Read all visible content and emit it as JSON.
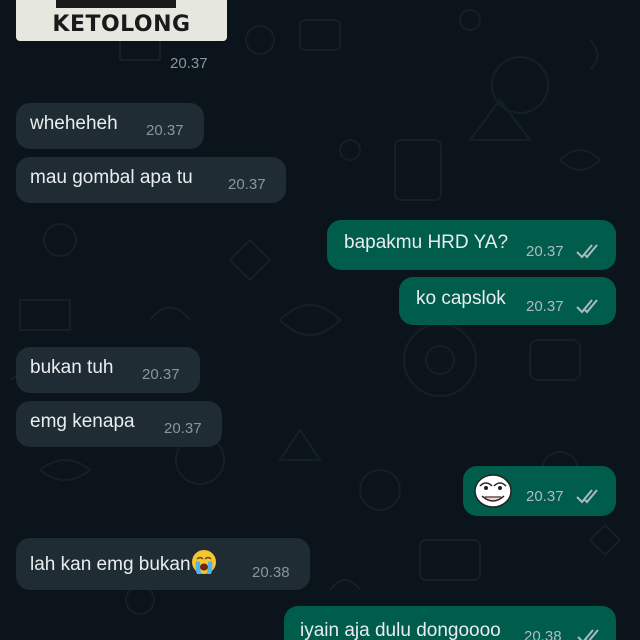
{
  "sticker": {
    "caption": "KETOLONG",
    "time": "20.37"
  },
  "messages": [
    {
      "direction": "in",
      "text": "wheheheh",
      "time": "20.37"
    },
    {
      "direction": "in",
      "text": "mau gombal apa tu",
      "time": "20.37"
    },
    {
      "direction": "out",
      "text": "bapakmu HRD YA?",
      "time": "20.37",
      "status": "read"
    },
    {
      "direction": "out",
      "text": "ko capslok",
      "time": "20.37",
      "status": "read"
    },
    {
      "direction": "in",
      "text": "bukan tuh",
      "time": "20.37"
    },
    {
      "direction": "in",
      "text": "emg kenapa",
      "time": "20.37"
    },
    {
      "direction": "out",
      "text": "",
      "time": "20.37",
      "status": "read",
      "sticker": "trollface-emoji"
    },
    {
      "direction": "in",
      "text": "lah kan emg bukan",
      "time": "20.38",
      "emoji": "loudly-crying-face"
    },
    {
      "direction": "out",
      "text": "iyain aja dulu dongoooo",
      "time": "20.38",
      "status": "read"
    }
  ],
  "colors": {
    "background": "#0b141a",
    "incoming_bubble": "#1f2c33",
    "outgoing_bubble": "#005c4b",
    "text": "#e9edef",
    "timestamp": "#8696a0",
    "tick": "#aebac1"
  }
}
